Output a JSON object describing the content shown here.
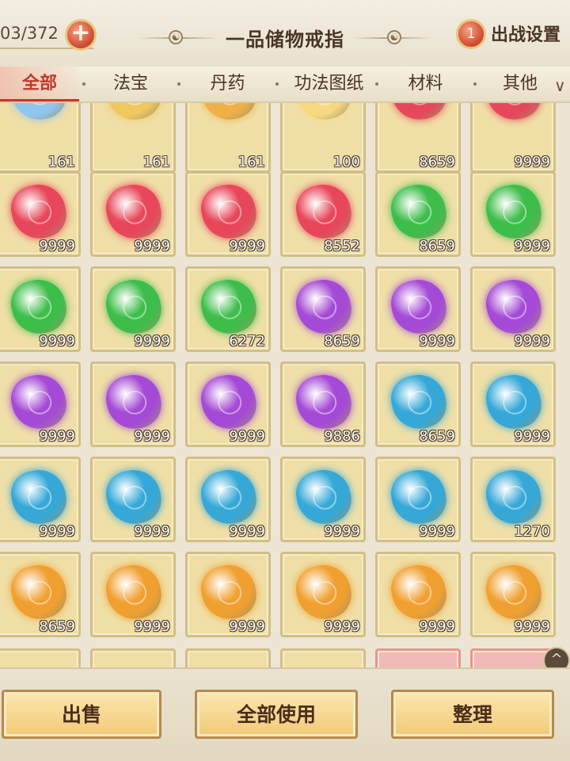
{
  "header": {
    "capacity": "03/372",
    "add_symbol": "+",
    "title": "一品储物戒指",
    "battle_badge": "1",
    "battle_label": "出战设置"
  },
  "tabs": [
    {
      "label": "全部",
      "active": true
    },
    {
      "label": "法宝",
      "active": false
    },
    {
      "label": "丹药",
      "active": false
    },
    {
      "label": "功法图纸",
      "active": false
    },
    {
      "label": "材料",
      "active": false
    },
    {
      "label": "其他",
      "active": false
    }
  ],
  "more_tabs_icon": "chevron-down-icon",
  "colors": {
    "red": "#e8465a",
    "green": "#3dbd4a",
    "purple": "#a54ad6",
    "cyan": "#35a8d8",
    "orange": "#f0a030",
    "white": "#bfe0f5",
    "gold": "#f0c860"
  },
  "inventory": {
    "rows": [
      [
        {
          "item": "crystal-shard",
          "color": "#8fc6ee",
          "count": "161"
        },
        {
          "item": "golden-feather",
          "color": "#f0c860",
          "count": "161"
        },
        {
          "item": "golden-feather",
          "color": "#f0b048",
          "count": "161"
        },
        {
          "item": "amber-crystal",
          "color": "#f7d880",
          "count": "100"
        },
        {
          "item": "red-gem",
          "color": "#e8465a",
          "count": "8659"
        },
        {
          "item": "red-gem",
          "color": "#e8465a",
          "count": "9999"
        }
      ],
      [
        {
          "item": "red-gem",
          "color": "#e8465a",
          "count": "9999"
        },
        {
          "item": "red-gem",
          "color": "#e8465a",
          "count": "9999"
        },
        {
          "item": "red-gem",
          "color": "#e8465a",
          "count": "9999"
        },
        {
          "item": "red-gem",
          "color": "#e8465a",
          "count": "8552"
        },
        {
          "item": "green-gem",
          "color": "#3dbd4a",
          "count": "8659"
        },
        {
          "item": "green-gem",
          "color": "#3dbd4a",
          "count": "9999"
        }
      ],
      [
        {
          "item": "green-gem",
          "color": "#3dbd4a",
          "count": "9999"
        },
        {
          "item": "green-gem",
          "color": "#3dbd4a",
          "count": "9999"
        },
        {
          "item": "green-gem",
          "color": "#3dbd4a",
          "count": "6272"
        },
        {
          "item": "purple-gem",
          "color": "#a54ad6",
          "count": "8659"
        },
        {
          "item": "purple-gem",
          "color": "#a54ad6",
          "count": "9999"
        },
        {
          "item": "purple-gem",
          "color": "#a54ad6",
          "count": "9999"
        }
      ],
      [
        {
          "item": "purple-gem",
          "color": "#a54ad6",
          "count": "9999"
        },
        {
          "item": "purple-gem",
          "color": "#a54ad6",
          "count": "9999"
        },
        {
          "item": "purple-gem",
          "color": "#a54ad6",
          "count": "9999"
        },
        {
          "item": "purple-gem",
          "color": "#a54ad6",
          "count": "9886"
        },
        {
          "item": "cyan-gem",
          "color": "#35a8d8",
          "count": "8659"
        },
        {
          "item": "cyan-gem",
          "color": "#35a8d8",
          "count": "9999"
        }
      ],
      [
        {
          "item": "cyan-gem",
          "color": "#35a8d8",
          "count": "9999"
        },
        {
          "item": "cyan-gem",
          "color": "#35a8d8",
          "count": "9999"
        },
        {
          "item": "cyan-gem",
          "color": "#35a8d8",
          "count": "9999"
        },
        {
          "item": "cyan-gem",
          "color": "#35a8d8",
          "count": "9999"
        },
        {
          "item": "cyan-gem",
          "color": "#35a8d8",
          "count": "9999"
        },
        {
          "item": "cyan-gem",
          "color": "#35a8d8",
          "count": "1270"
        }
      ],
      [
        {
          "item": "orange-gem",
          "color": "#f0a030",
          "count": "8659"
        },
        {
          "item": "orange-gem",
          "color": "#f0a030",
          "count": "9999"
        },
        {
          "item": "orange-gem",
          "color": "#f0a030",
          "count": "9999"
        },
        {
          "item": "orange-gem",
          "color": "#f0a030",
          "count": "9999"
        },
        {
          "item": "orange-gem",
          "color": "#f0a030",
          "count": "9999"
        },
        {
          "item": "orange-gem",
          "color": "#f0a030",
          "count": "9999"
        }
      ],
      [
        {
          "item": "empty",
          "color": "",
          "count": ""
        },
        {
          "item": "empty",
          "color": "",
          "count": ""
        },
        {
          "item": "empty",
          "color": "",
          "count": ""
        },
        {
          "item": "empty",
          "color": "",
          "count": ""
        },
        {
          "item": "empty-pink",
          "color": "",
          "count": ""
        },
        {
          "item": "empty-pink",
          "color": "",
          "count": ""
        }
      ]
    ]
  },
  "scroll_top_icon": "arrow-up-icon",
  "bottom": {
    "sell": "出售",
    "use_all": "全部使用",
    "sort": "整理"
  }
}
